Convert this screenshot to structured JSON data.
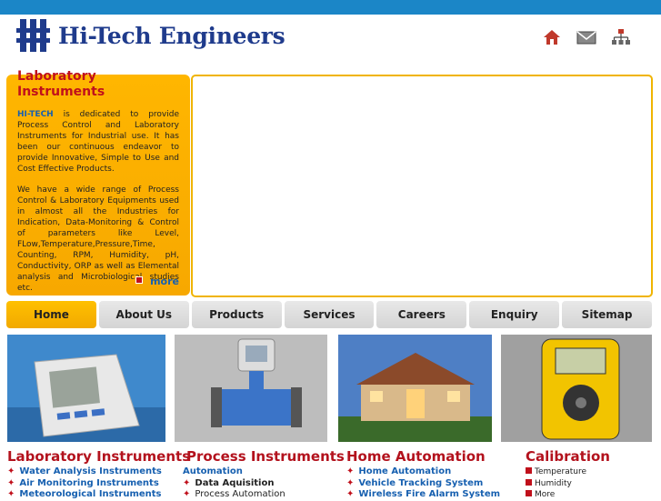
{
  "brand": {
    "name": "Hi-Tech Engineers"
  },
  "header_icons": [
    "home-icon",
    "mail-icon",
    "sitemap-icon"
  ],
  "intro": {
    "title": "Laboratory Instruments",
    "brand": "HI-TECH",
    "para1": " is dedicated to provide Process Control and Laboratory Instruments for Industrial use. It has been our continuous endeavor to provide Innovative, Simple to Use and Cost Effective Products.",
    "para2": "We have a wide range of Process Control & Laboratory Equipments used in almost all the Industries for Indication, Data-Monitoring & Control of parameters like Level, FLow,Temperature,Pressure,Time, Counting, RPM, Humidity, pH, Conductivity, ORP as well as Elemental analysis and Microbiological studies etc.",
    "more": "more"
  },
  "nav": [
    "Home",
    "About Us",
    "Products",
    "Services",
    "Careers",
    "Enquiry",
    "Sitemap"
  ],
  "sections": [
    {
      "title": "Laboratory Instruments",
      "items": [
        "Water Analysis Instruments",
        "Air Monitoring Instruments",
        "Meteorological Instruments"
      ]
    },
    {
      "title": "Process Instruments",
      "items": [
        "Automation",
        "Data Aquisition",
        "Process Automation"
      ]
    },
    {
      "title": "Home Automation",
      "items": [
        "Home Automation",
        "Vehicle Tracking System",
        "Wireless Fire Alarm System"
      ]
    },
    {
      "title": "Calibration",
      "items": [
        "Temperature",
        "Humidity",
        "More"
      ]
    }
  ],
  "colors": {
    "topbar": "#1b86c7",
    "accent": "#f7a800",
    "heading": "#b3121d",
    "link": "#1760b0"
  }
}
